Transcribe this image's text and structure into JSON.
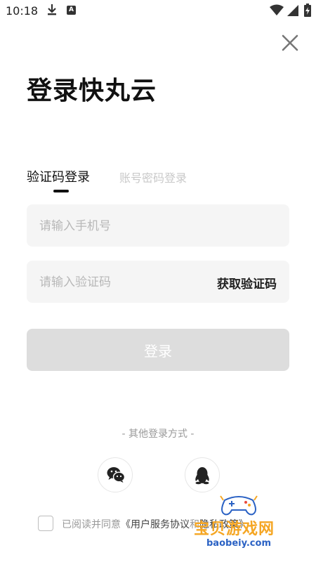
{
  "status_bar": {
    "time": "10:18",
    "download_icon": "download-icon",
    "app_badge": "A"
  },
  "header": {
    "title": "登录快丸云",
    "close_icon": "close-icon"
  },
  "tabs": [
    {
      "label": "验证码登录",
      "active": true
    },
    {
      "label": "账号密码登录",
      "active": false
    }
  ],
  "form": {
    "phone": {
      "placeholder": "请输入手机号",
      "value": ""
    },
    "code": {
      "placeholder": "请输入验证码",
      "value": ""
    },
    "get_code_label": "获取验证码",
    "submit_label": "登录"
  },
  "other_login": {
    "label": "- 其他登录方式 -",
    "methods": [
      "wechat-icon",
      "qq-icon"
    ]
  },
  "agreement": {
    "prefix": "已阅读并同意",
    "link1": "《用户服务协议",
    "rest": "和",
    "link2": "隐私政策》"
  },
  "watermark": {
    "text": "宝贝游戏网",
    "url": "baobeiy.com"
  },
  "colors": {
    "accent": "#111111",
    "button_disabled": "#dddddd",
    "field_bg": "#f5f5f5",
    "muted": "#999999",
    "watermark": "#f5a623"
  }
}
